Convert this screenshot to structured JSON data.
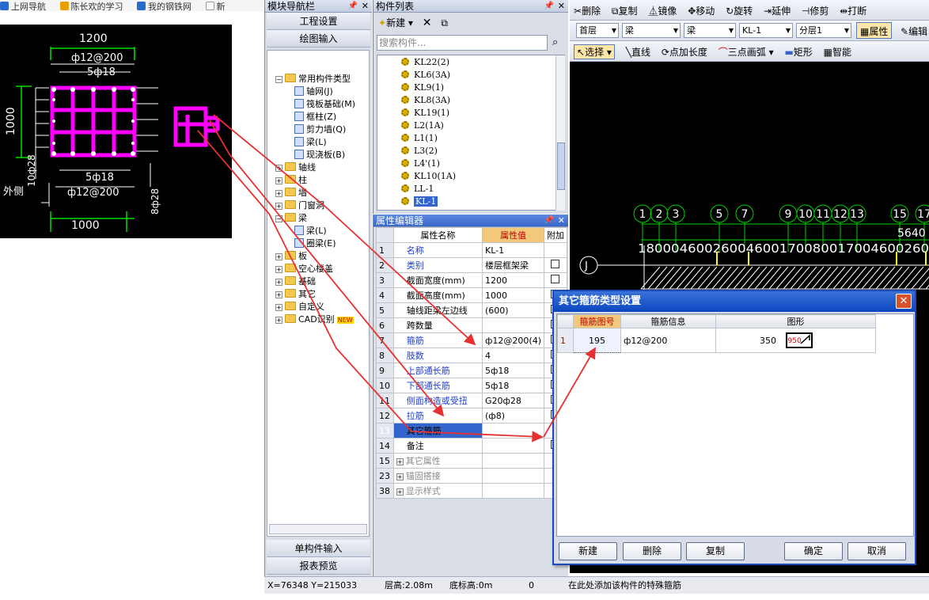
{
  "browser_tabs": [
    "上网导航",
    "陈长欢的学习",
    "我的钢铁网",
    "新"
  ],
  "cad_thumb": {
    "dim_top": "1200",
    "top_bar": "ф12@200",
    "top_main": "5ф18",
    "left_dim": "1000",
    "bottom_main": "5ф18",
    "bottom_bar": "ф12@200",
    "bottom_dim": "1000",
    "left_side": "外侧",
    "left_rebar": "10ф28",
    "right_rebar": "8ф28"
  },
  "module_panel": {
    "title": "模块导航栏",
    "btn_engineering": "工程设置",
    "btn_drawing": "绘图输入",
    "btn_single": "单构件输入",
    "btn_report": "报表预览"
  },
  "tree": [
    {
      "label": "常用构件类型",
      "box": "−",
      "kind": "folder",
      "level": 0
    },
    {
      "label": "轴网(J)",
      "kind": "item",
      "level": 2
    },
    {
      "label": "筏板基础(M)",
      "kind": "item",
      "level": 2
    },
    {
      "label": "框柱(Z)",
      "kind": "item",
      "level": 2
    },
    {
      "label": "剪力墙(Q)",
      "kind": "item",
      "level": 2
    },
    {
      "label": "梁(L)",
      "kind": "item",
      "level": 2
    },
    {
      "label": "现浇板(B)",
      "kind": "item",
      "level": 2
    },
    {
      "label": "轴线",
      "box": "+",
      "kind": "folder",
      "level": 0
    },
    {
      "label": "柱",
      "box": "+",
      "kind": "folder",
      "level": 0
    },
    {
      "label": "墙",
      "box": "+",
      "kind": "folder",
      "level": 0
    },
    {
      "label": "门窗洞",
      "box": "+",
      "kind": "folder",
      "level": 0
    },
    {
      "label": "梁",
      "box": "−",
      "kind": "folder",
      "level": 0
    },
    {
      "label": "梁(L)",
      "kind": "item",
      "level": 2
    },
    {
      "label": "圈梁(E)",
      "kind": "item",
      "level": 2
    },
    {
      "label": "板",
      "box": "+",
      "kind": "folder",
      "level": 0
    },
    {
      "label": "空心楼盖",
      "box": "+",
      "kind": "folder",
      "level": 0
    },
    {
      "label": "基础",
      "box": "+",
      "kind": "folder",
      "level": 0
    },
    {
      "label": "其它",
      "box": "+",
      "kind": "folder",
      "level": 0
    },
    {
      "label": "自定义",
      "box": "+",
      "kind": "folder",
      "level": 0
    },
    {
      "label": "CAD识别",
      "box": "+",
      "kind": "folder",
      "level": 0,
      "badge": "NEW"
    }
  ],
  "component_list": {
    "title": "构件列表",
    "new_label": "新建",
    "search_placeholder": "搜索构件...",
    "items": [
      "KL22(2)",
      "KL6(3A)",
      "KL9(1)",
      "KL8(3A)",
      "KL19(1)",
      "L2(1A)",
      "L1(1)",
      "L3(2)",
      "L4'(1)",
      "KL10(1A)",
      "LL-1",
      "KL-1"
    ],
    "selected": "KL-1"
  },
  "property_editor": {
    "title": "属性编辑器",
    "col_name": "属性名称",
    "col_value": "属性值",
    "col_extra": "附加",
    "rows": [
      {
        "n": "1",
        "name": "名称",
        "value": "KL-1",
        "blue": true,
        "chk": false
      },
      {
        "n": "2",
        "name": "类别",
        "value": "楼层框架梁",
        "blue": true,
        "chk": true
      },
      {
        "n": "3",
        "name": "截面宽度(mm)",
        "value": "1200",
        "blue": false,
        "chk": true
      },
      {
        "n": "4",
        "name": "截面高度(mm)",
        "value": "1000",
        "blue": false,
        "chk": true
      },
      {
        "n": "5",
        "name": "轴线距梁左边线",
        "value": "(600)",
        "blue": false,
        "chk": true
      },
      {
        "n": "6",
        "name": "跨数量",
        "value": "",
        "blue": false,
        "chk": true
      },
      {
        "n": "7",
        "name": "箍筋",
        "value": "ф12@200(4)",
        "blue": true,
        "chk": true
      },
      {
        "n": "8",
        "name": "肢数",
        "value": "4",
        "blue": true,
        "chk": true
      },
      {
        "n": "9",
        "name": "上部通长筋",
        "value": "5ф18",
        "blue": true,
        "chk": true
      },
      {
        "n": "10",
        "name": "下部通长筋",
        "value": "5ф18",
        "blue": true,
        "chk": true
      },
      {
        "n": "11",
        "name": "侧面构造或受扭",
        "value": "G20ф28",
        "blue": true,
        "chk": true
      },
      {
        "n": "12",
        "name": "拉筋",
        "value": "(ф8)",
        "blue": true,
        "chk": true
      },
      {
        "n": "13",
        "name": "其它箍筋",
        "value": "",
        "blue": false,
        "chk": false,
        "selected": true
      },
      {
        "n": "14",
        "name": "备注",
        "value": "",
        "blue": false,
        "chk": true
      },
      {
        "n": "15",
        "name": "其它属性",
        "value": "",
        "blue": false,
        "chk": false,
        "group": true
      },
      {
        "n": "23",
        "name": "锚固搭接",
        "value": "",
        "blue": false,
        "chk": false,
        "group": true
      },
      {
        "n": "38",
        "name": "显示样式",
        "value": "",
        "blue": false,
        "chk": false,
        "group": true
      }
    ]
  },
  "toolbar1": [
    "删除",
    "复制",
    "镜像",
    "移动",
    "旋转",
    "延伸",
    "修剪",
    "打断"
  ],
  "toolbar2": {
    "floor": "首层",
    "type1": "梁",
    "type2": "梁",
    "member": "KL-1",
    "layer": "分层1",
    "prop_btn": "属性",
    "edit_btn": "编辑"
  },
  "toolbar3": [
    "选择",
    "直线",
    "点加长度",
    "三点画弧",
    "矩形",
    "智能"
  ],
  "canvas": {
    "axis_numbers": [
      "1",
      "2",
      "3",
      "5",
      "7",
      "9",
      "10",
      "11",
      "12",
      "13",
      "15",
      "17"
    ],
    "dim_top": "5640",
    "dims_row": "18000460026004600170080017004600260",
    "axis_j": "J"
  },
  "dialog": {
    "title": "其它箍筋类型设置",
    "col_num": "箍筋图号",
    "col_info": "箍筋信息",
    "col_shape": "图形",
    "row_index": "1",
    "row_num": "195",
    "row_info": "ф12@200",
    "row_len": "350",
    "row_shape_text": "950",
    "btn_new": "新建",
    "btn_delete": "删除",
    "btn_copy": "复制",
    "btn_ok": "确定",
    "btn_cancel": "取消"
  },
  "statusbar": {
    "coords": "X=76348  Y=215033",
    "floor_height": "层高:2.08m",
    "bottom_elev": "底标高:0m",
    "zero": "0",
    "hint": "在此处添加该构件的特殊箍筋"
  },
  "colors": {
    "accent": "#3366cc",
    "magenta": "#ff00ff",
    "arrow": "#e83030",
    "title_bar": "#0a46c0"
  }
}
